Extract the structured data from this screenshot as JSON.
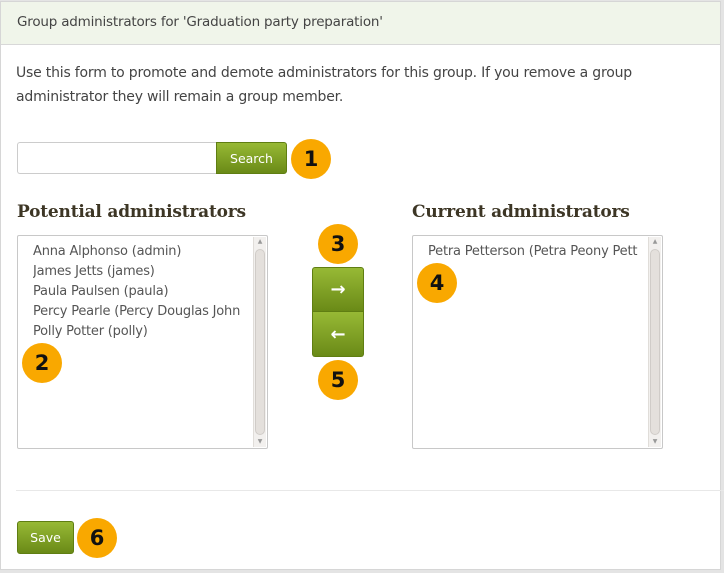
{
  "panel": {
    "title": "Group administrators for 'Graduation party preparation'",
    "description": "Use this form to promote and demote administrators for this group. If you remove a group administrator they will remain a group member."
  },
  "search": {
    "value": "",
    "placeholder": "",
    "button_label": "Search"
  },
  "potential": {
    "heading": "Potential administrators",
    "items": [
      "Anna Alphonso (admin)",
      "James Jetts (james)",
      "Paula Paulsen (paula)",
      "Percy Pearle (Percy Douglas John",
      "Polly Potter (polly)"
    ]
  },
  "current": {
    "heading": "Current administrators",
    "items": [
      "Petra Petterson (Petra Peony Pett"
    ]
  },
  "move_buttons": {
    "add_icon": "→",
    "remove_icon": "←"
  },
  "save_label": "Save",
  "callouts": [
    "1",
    "2",
    "3",
    "4",
    "5",
    "6"
  ],
  "colors": {
    "accent_green": "#7a9a22",
    "callout_orange": "#f9a800",
    "header_bg": "#f0f5ea"
  }
}
